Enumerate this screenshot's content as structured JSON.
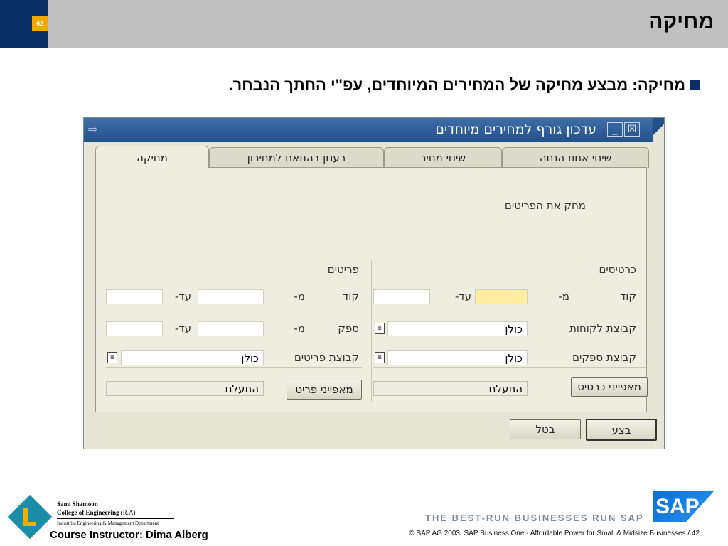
{
  "slide": {
    "page_number": "42",
    "title": "מחיקה",
    "bullet_text": "מחיקה: מבצע מחיקה של המחירים המיוחדים, עפ\"י החתך הנבחר."
  },
  "window": {
    "title": "עדכון גורף למחירים מיוחדים",
    "close_icon": "☒",
    "minimize_icon": "_",
    "system_icon": "⇨"
  },
  "tabs": [
    {
      "label": "שינוי אחוז הנחה"
    },
    {
      "label": "שינוי מחיר"
    },
    {
      "label": "רענון בהתאם למחירון"
    },
    {
      "label": "מחיקה"
    }
  ],
  "form": {
    "delete_items_label": "מחק את הפריטים",
    "cards": {
      "header": "כרטיסים",
      "code_label": "קוד",
      "from_label": "מ-",
      "to_label": "עד-",
      "code_from_value": "",
      "code_to_value": "",
      "customer_group_label": "קבוצת לקוחות",
      "customer_group_value": "כולן",
      "vendor_group_label": "קבוצת ספקים",
      "vendor_group_value": "כולן",
      "properties_button": "מאפייני כרטיס",
      "ignore_value": "התעלם"
    },
    "items": {
      "header": "פריטים",
      "code_label": "קוד",
      "from_label": "מ-",
      "to_label": "עד-",
      "code_from_value": "",
      "code_to_value": "",
      "vendor_label": "ספק",
      "vendor_from_value": "",
      "vendor_to_value": "",
      "item_group_label": "קבוצת פריטים",
      "item_group_value": "כולן",
      "properties_button": "מאפייני פריט",
      "ignore_value": "התעלם"
    }
  },
  "buttons": {
    "execute": "בצע",
    "cancel": "בטל"
  },
  "footer": {
    "name": "Sami Shamoon",
    "college": "College of Engineering",
    "college_ra": "(R.A)",
    "department": "Industrial Engineering & Management Department",
    "instructor": "Course Instructor: Dima Alberg",
    "tagline": "THE BEST-RUN BUSINESSES RUN SAP",
    "sap_logo": "SAP",
    "copyright": "©  SAP AG 2003, SAP Business One - Affordable Power for Small & Midsize Businesses / 42"
  },
  "colors": {
    "header_blue": "#0b2e66",
    "page_badge": "#f0a800",
    "title_bar": "#24508a",
    "highlight_field": "#ffeea0"
  }
}
